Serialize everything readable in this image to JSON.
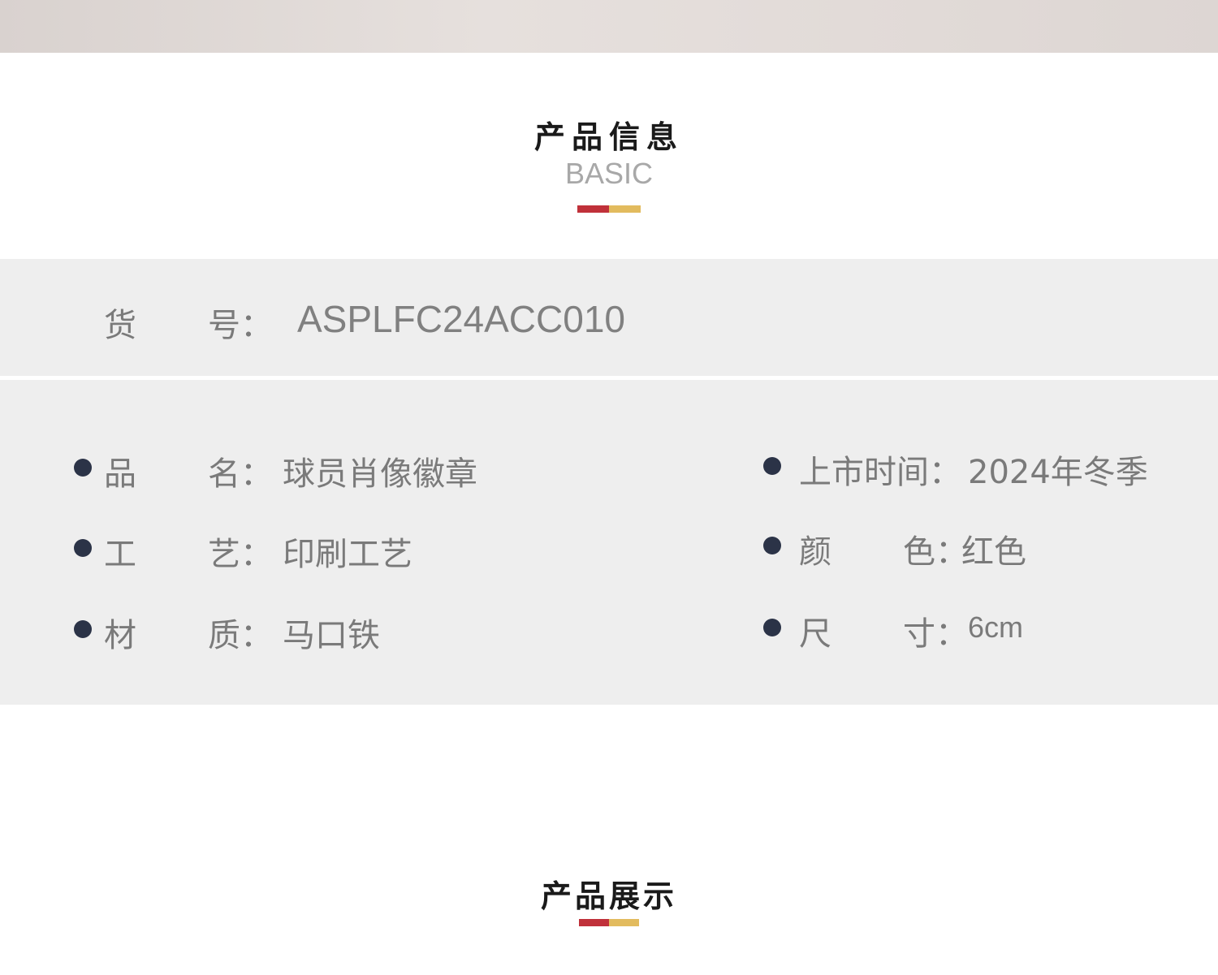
{
  "product_info": {
    "title": "产品信息",
    "subtitle": "BASIC",
    "accent_colors": {
      "red": "#c0313a",
      "gold": "#e2bb5e"
    },
    "sku": {
      "label_first": "货",
      "label_last": "号：",
      "value": "ASPLFC24ACC010"
    },
    "left_fields": [
      {
        "label_first": "品",
        "label_last": "名：",
        "value": "球员肖像徽章"
      },
      {
        "label_first": "工",
        "label_last": "艺：",
        "value": "印刷工艺"
      },
      {
        "label_first": "材",
        "label_last": "质：",
        "value": "马口铁"
      }
    ],
    "right_fields": [
      {
        "label": "上市时间：",
        "value": "2024年冬季"
      },
      {
        "label_first": "颜",
        "label_last": "色：",
        "value": "红色"
      },
      {
        "label_first": "尺",
        "label_last": "寸：",
        "value": "6cm"
      }
    ]
  },
  "product_display": {
    "title": "产品展示"
  }
}
